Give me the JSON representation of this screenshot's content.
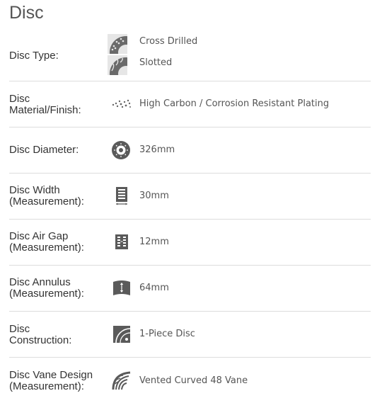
{
  "title": "Disc",
  "rows": [
    {
      "label_lines": [
        "Disc Type:"
      ],
      "values": [
        "Cross Drilled",
        "Slotted"
      ],
      "icons": [
        "cross-drilled-disc-icon",
        "slotted-disc-icon"
      ]
    },
    {
      "label_lines": [
        "Disc",
        "Material/Finish:"
      ],
      "values": [
        "High Carbon / Corrosion Resistant Plating"
      ],
      "icons": [
        "material-particles-icon"
      ]
    },
    {
      "label_lines": [
        "Disc Diameter:"
      ],
      "values": [
        "326mm"
      ],
      "icons": [
        "diameter-disc-icon"
      ]
    },
    {
      "label_lines": [
        "Disc Width",
        "(Measurement):"
      ],
      "values": [
        "30mm"
      ],
      "icons": [
        "disc-width-icon"
      ]
    },
    {
      "label_lines": [
        "Disc Air Gap",
        "(Measurement):"
      ],
      "values": [
        "12mm"
      ],
      "icons": [
        "air-gap-icon"
      ]
    },
    {
      "label_lines": [
        "Disc Annulus",
        "(Measurement):"
      ],
      "values": [
        "64mm"
      ],
      "icons": [
        "annulus-icon"
      ]
    },
    {
      "label_lines": [
        "Disc",
        "Construction:"
      ],
      "values": [
        "1-Piece Disc"
      ],
      "icons": [
        "construction-icon"
      ]
    },
    {
      "label_lines": [
        "Disc Vane Design",
        "(Measurement):"
      ],
      "values": [
        "Vented Curved 48 Vane"
      ],
      "icons": [
        "curved-vane-icon"
      ]
    }
  ],
  "colors": {
    "icon": "#555555",
    "divider": "#dddddd",
    "label": "#333333",
    "value": "#555555"
  }
}
